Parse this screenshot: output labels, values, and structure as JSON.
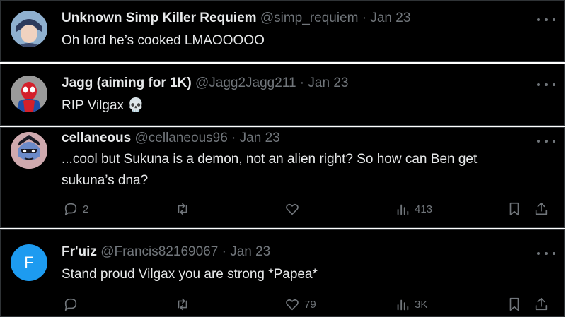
{
  "replies": [
    {
      "name": "Unknown Simp Killer Requiem",
      "handle": "@simp_requiem",
      "separator": "·",
      "date": "Jan 23",
      "text": "Oh lord he’s cooked LMAOOOOO",
      "avatar": "anime-character-avatar"
    },
    {
      "name": "Jagg (aiming for 1K)",
      "handle": "@Jagg2Jagg211",
      "separator": "·",
      "date": "Jan 23",
      "text": "RIP Vilgax",
      "emoji": "💀",
      "avatar": "spider-man-avatar"
    },
    {
      "name": "cellaneous",
      "handle": "@cellaneous96",
      "separator": "·",
      "date": "Jan 23",
      "text": "...cool but Sukuna is a demon, not an alien right? So how can Ben get sukuna’s dna?",
      "avatar": "cartoon-villain-avatar",
      "stats": {
        "replies": "2",
        "reposts": "",
        "likes": "",
        "views": "413"
      }
    },
    {
      "name": "Fr'uiz",
      "handle": "@Francis82169067",
      "separator": "·",
      "date": "Jan 23",
      "text": "Stand proud Vilgax you are strong *Papea*",
      "avatar_letter": "F",
      "stats": {
        "replies": "",
        "reposts": "",
        "likes": "79",
        "views": "3K"
      }
    }
  ],
  "colors": {
    "background": "#000000",
    "primary_text": "#e7e9ea",
    "secondary_text": "#71767b",
    "border": "#2f3336",
    "avatar_f": "#1d9bf0"
  },
  "icons": [
    "reply-icon",
    "repost-icon",
    "like-icon",
    "views-icon",
    "bookmark-icon",
    "share-icon",
    "more-icon"
  ]
}
